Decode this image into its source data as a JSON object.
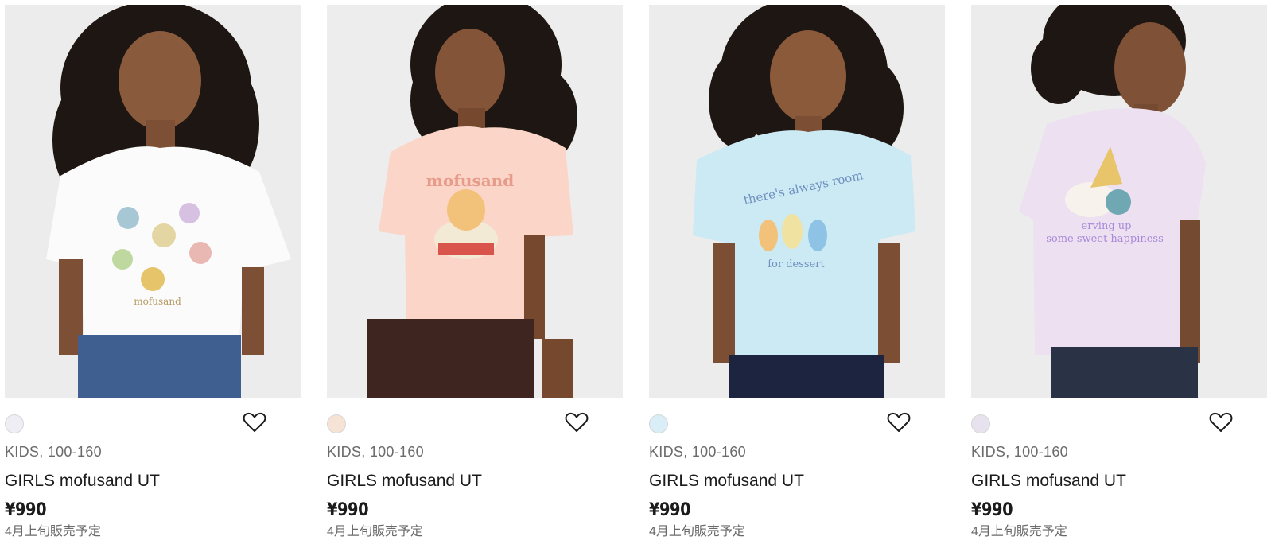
{
  "products": [
    {
      "category": "KIDS, 100-160",
      "name": "GIRLS mofusand UT",
      "price": "¥990",
      "availability": "4月上旬販売予定",
      "swatch_color": "#eeeef4",
      "shirt_color": "#fbfbfb",
      "bottom_color": "#3e5f8f",
      "print_text": "mofusand",
      "print_color": "#b59a63"
    },
    {
      "category": "KIDS, 100-160",
      "name": "GIRLS mofusand UT",
      "price": "¥990",
      "availability": "4月上旬販売予定",
      "swatch_color": "#f7e2d6",
      "shirt_color": "#fbd6c8",
      "bottom_color": "#3f2520",
      "print_text": "mofusand",
      "print_color": "#e69b8b"
    },
    {
      "category": "KIDS, 100-160",
      "name": "GIRLS mofusand UT",
      "price": "¥990",
      "availability": "4月上旬販売予定",
      "swatch_color": "#d9eef6",
      "shirt_color": "#cbeaf4",
      "bottom_color": "#1c2440",
      "print_text": "there's always room",
      "print_sub": "for dessert",
      "print_color": "#6f8fbf"
    },
    {
      "category": "KIDS, 100-160",
      "name": "GIRLS mofusand UT",
      "price": "¥990",
      "availability": "4月上旬販売予定",
      "swatch_color": "#e8e2ee",
      "shirt_color": "#ece0f1",
      "bottom_color": "#2a3346",
      "print_text": "erving up",
      "print_sub": "some sweet happiness",
      "print_color": "#a98ad8"
    }
  ]
}
